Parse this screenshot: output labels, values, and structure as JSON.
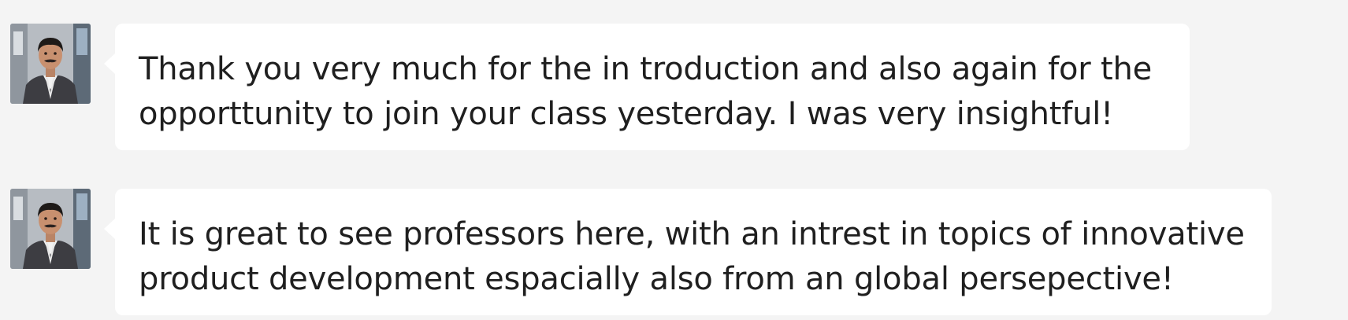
{
  "messages": [
    {
      "avatar_icon": "user-avatar-photo",
      "lines": [
        "Thank you very much for the in troduction and also again for the",
        "opporttunity to join your class yesterday. I was very insightful!"
      ]
    },
    {
      "avatar_icon": "user-avatar-photo",
      "lines": [
        "It is great to see professors here, with an intrest in topics of innovative",
        "product development espacially also from an global persepective!"
      ]
    }
  ],
  "colors": {
    "page_background": "#f4f4f4",
    "bubble_background": "#ffffff",
    "text": "#1f1f1f"
  }
}
